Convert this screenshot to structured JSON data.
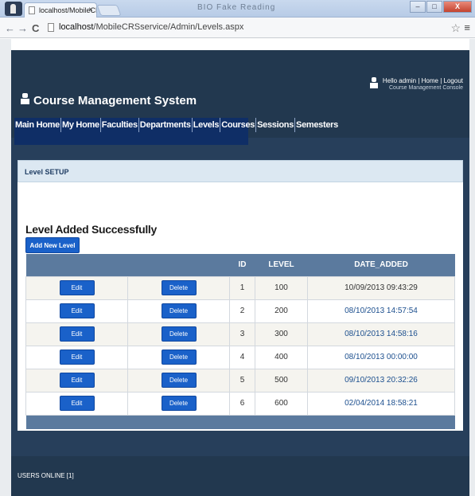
{
  "browser": {
    "tab_title": "localhost/MobileCRSserv",
    "tab_close": "×",
    "window_title": "BIO Fake Reading",
    "url_host": "localhost",
    "url_path": "/MobileCRSservice/Admin/Levels.aspx",
    "back_glyph": "←",
    "forward_glyph": "→",
    "reload_glyph": "C",
    "star_glyph": "☆",
    "menu_glyph": "≡",
    "minimize": "–",
    "maximize": "□",
    "close": "X"
  },
  "header": {
    "site_title": "Course Management System",
    "greeting": "Hello admin",
    "home_link": "Home",
    "logout_link": "Logout",
    "subtitle": "Course Management Console",
    "separator": "|"
  },
  "nav": {
    "items": [
      {
        "label": "Main Home"
      },
      {
        "label": "My Home"
      },
      {
        "label": "Faculties"
      },
      {
        "label": "Departments"
      },
      {
        "label": "Levels"
      },
      {
        "label": "Courses"
      },
      {
        "label": "Sessions"
      },
      {
        "label": "Semesters"
      }
    ]
  },
  "main": {
    "section_title": "Level SETUP",
    "message": "Level Added Successfully",
    "add_button": "Add New Level",
    "table": {
      "headers": [
        "",
        "",
        "ID",
        "LEVEL",
        "DATE_ADDED"
      ],
      "edit_label": "Edit",
      "delete_label": "Delete",
      "rows": [
        {
          "id": "1",
          "level": "100",
          "date": "10/09/2013 09:43:29"
        },
        {
          "id": "2",
          "level": "200",
          "date": "08/10/2013 14:57:54"
        },
        {
          "id": "3",
          "level": "300",
          "date": "08/10/2013 14:58:16"
        },
        {
          "id": "4",
          "level": "400",
          "date": "08/10/2013 00:00:00"
        },
        {
          "id": "5",
          "level": "500",
          "date": "09/10/2013 20:32:26"
        },
        {
          "id": "6",
          "level": "600",
          "date": "02/04/2014 18:58:21"
        }
      ]
    }
  },
  "footer": {
    "users_online": "USERS ONLINE [1]"
  },
  "colors": {
    "header_bg": "#22384f",
    "nav_bg": "#0f2e66",
    "button_blue": "#1a61c9",
    "table_header": "#5b7a9e"
  }
}
